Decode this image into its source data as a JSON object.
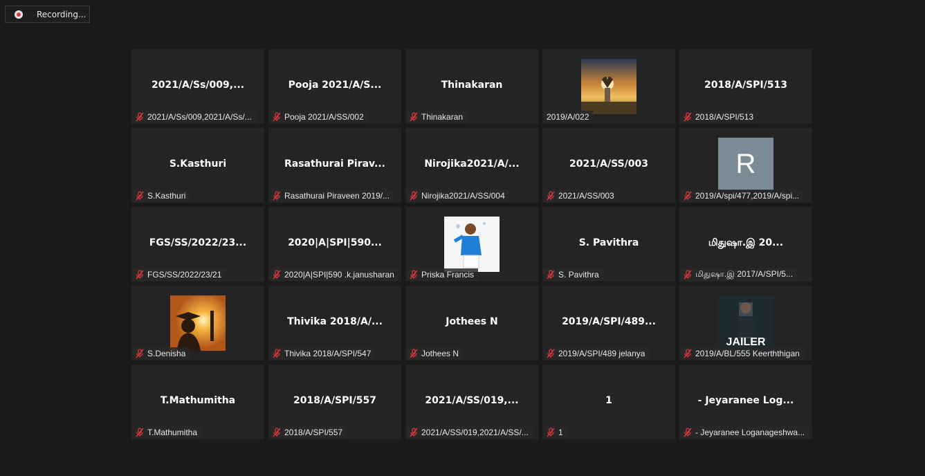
{
  "recording": {
    "label": "Recording..."
  },
  "tiles": [
    {
      "center": "2021/A/Ss/009,...",
      "tag": "2021/A/Ss/009,2021/A/Ss/...",
      "muted": true
    },
    {
      "center": "Pooja 2021/A/S...",
      "tag": "Pooja 2021/A/SS/002",
      "muted": true
    },
    {
      "center": "Thinakaran",
      "tag": "Thinakaran",
      "muted": true
    },
    {
      "center": "",
      "tag": "2019/A/022",
      "muted": false,
      "avatar": "sunset-heart"
    },
    {
      "center": "2018/A/SPI/513",
      "tag": "2018/A/SPI/513",
      "muted": true
    },
    {
      "center": "S.Kasthuri",
      "tag": "S.Kasthuri",
      "muted": true
    },
    {
      "center": "Rasathurai  Pirav...",
      "tag": "Rasathurai Piraveen 2019/...",
      "muted": true
    },
    {
      "center": "Nirojika2021/A/...",
      "tag": "Nirojika2021/A/SS/004",
      "muted": true
    },
    {
      "center": "2021/A/SS/003",
      "tag": "2021/A/SS/003",
      "muted": true
    },
    {
      "center": "",
      "tag": "2019/A/spi/477,2019/A/spi...",
      "muted": true,
      "letter": "R"
    },
    {
      "center": "FGS/SS/2022/23...",
      "tag": "FGS/SS/2022/23/21",
      "muted": true
    },
    {
      "center": "2020|A|SPI|590...",
      "tag": "2020|A|SPI|590 .k.janusharan",
      "muted": true
    },
    {
      "center": "",
      "tag": "Priska Francis",
      "muted": true,
      "avatar": "child-blue"
    },
    {
      "center": "S. Pavithra",
      "tag": "S. Pavithra",
      "muted": true
    },
    {
      "center": "மிதுஷா.இ  20...",
      "tag": "மிதுஷா.இ  2017/A/SPI/5...",
      "muted": true
    },
    {
      "center": "",
      "tag": "S.Denisha",
      "muted": true,
      "avatar": "graduation"
    },
    {
      "center": "Thivika 2018/A/...",
      "tag": "Thivika 2018/A/SPI/547",
      "muted": true
    },
    {
      "center": "Jothees N",
      "tag": "Jothees N",
      "muted": true
    },
    {
      "center": "2019/A/SPI/489...",
      "tag": "2019/A/SPI/489 jelanya",
      "muted": true
    },
    {
      "center": "",
      "tag": "2019/A/BL/555 Keerththigan",
      "muted": true,
      "avatar": "jailer-poster"
    },
    {
      "center": "T.Mathumitha",
      "tag": "T.Mathumitha",
      "muted": true
    },
    {
      "center": "2018/A/SPI/557",
      "tag": "2018/A/SPI/557",
      "muted": true
    },
    {
      "center": "2021/A/SS/019,...",
      "tag": "2021/A/SS/019,2021/A/SS/...",
      "muted": true
    },
    {
      "center": "1",
      "tag": "1",
      "muted": true
    },
    {
      "center": "- Jeyaranee Log...",
      "tag": "- Jeyaranee Loganageshwa...",
      "muted": true
    }
  ],
  "avatar_texts": {
    "poster_title": "JAILER"
  },
  "colors": {
    "background": "#1a1a1a",
    "tile": "#242424",
    "mute_red": "#d9383e",
    "letter_avatar": "#7a8b96"
  }
}
